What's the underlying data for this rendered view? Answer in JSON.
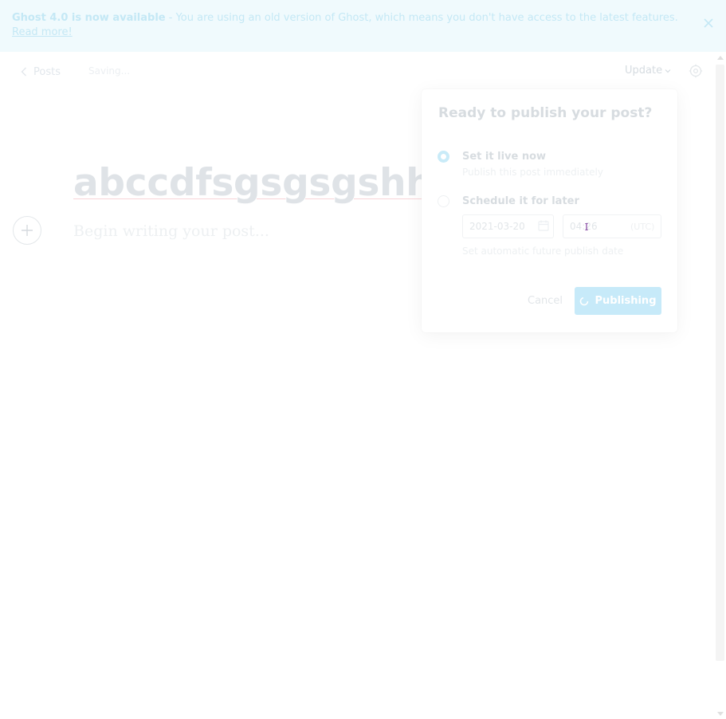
{
  "banner": {
    "strong_text": "Ghost 4.0 is now available",
    "message": " - You are using an old version of Ghost, which means you don't have access to the latest features.",
    "link_label": "Read more!",
    "close_icon": "close-icon"
  },
  "header": {
    "back_label": "Posts",
    "back_icon": "chevron-left-icon",
    "status": "Saving...",
    "update_label": "Update",
    "update_icon": "chevron-down-icon",
    "settings_icon": "settings-icon"
  },
  "editor": {
    "title": "abccdfsgsgsgshhh",
    "body_placeholder": "Begin writing your post...",
    "plus_icon": "plus-icon"
  },
  "publish_popover": {
    "title": "Ready to publish your post?",
    "options": [
      {
        "label": "Set it live now",
        "description": "Publish this post immediately",
        "selected": true
      },
      {
        "label": "Schedule it for later",
        "description": "Set automatic future publish date",
        "selected": false
      }
    ],
    "schedule": {
      "date": "2021-03-20",
      "time": "04:26",
      "timezone": "(UTC)"
    },
    "cancel_label": "Cancel",
    "publish_label": "Publishing",
    "spinner_icon": "spinner-icon"
  },
  "colors": {
    "accent": "#c7eaf9",
    "banner_bg": "#f0fafd",
    "banner_text": "#c4e8f5"
  }
}
